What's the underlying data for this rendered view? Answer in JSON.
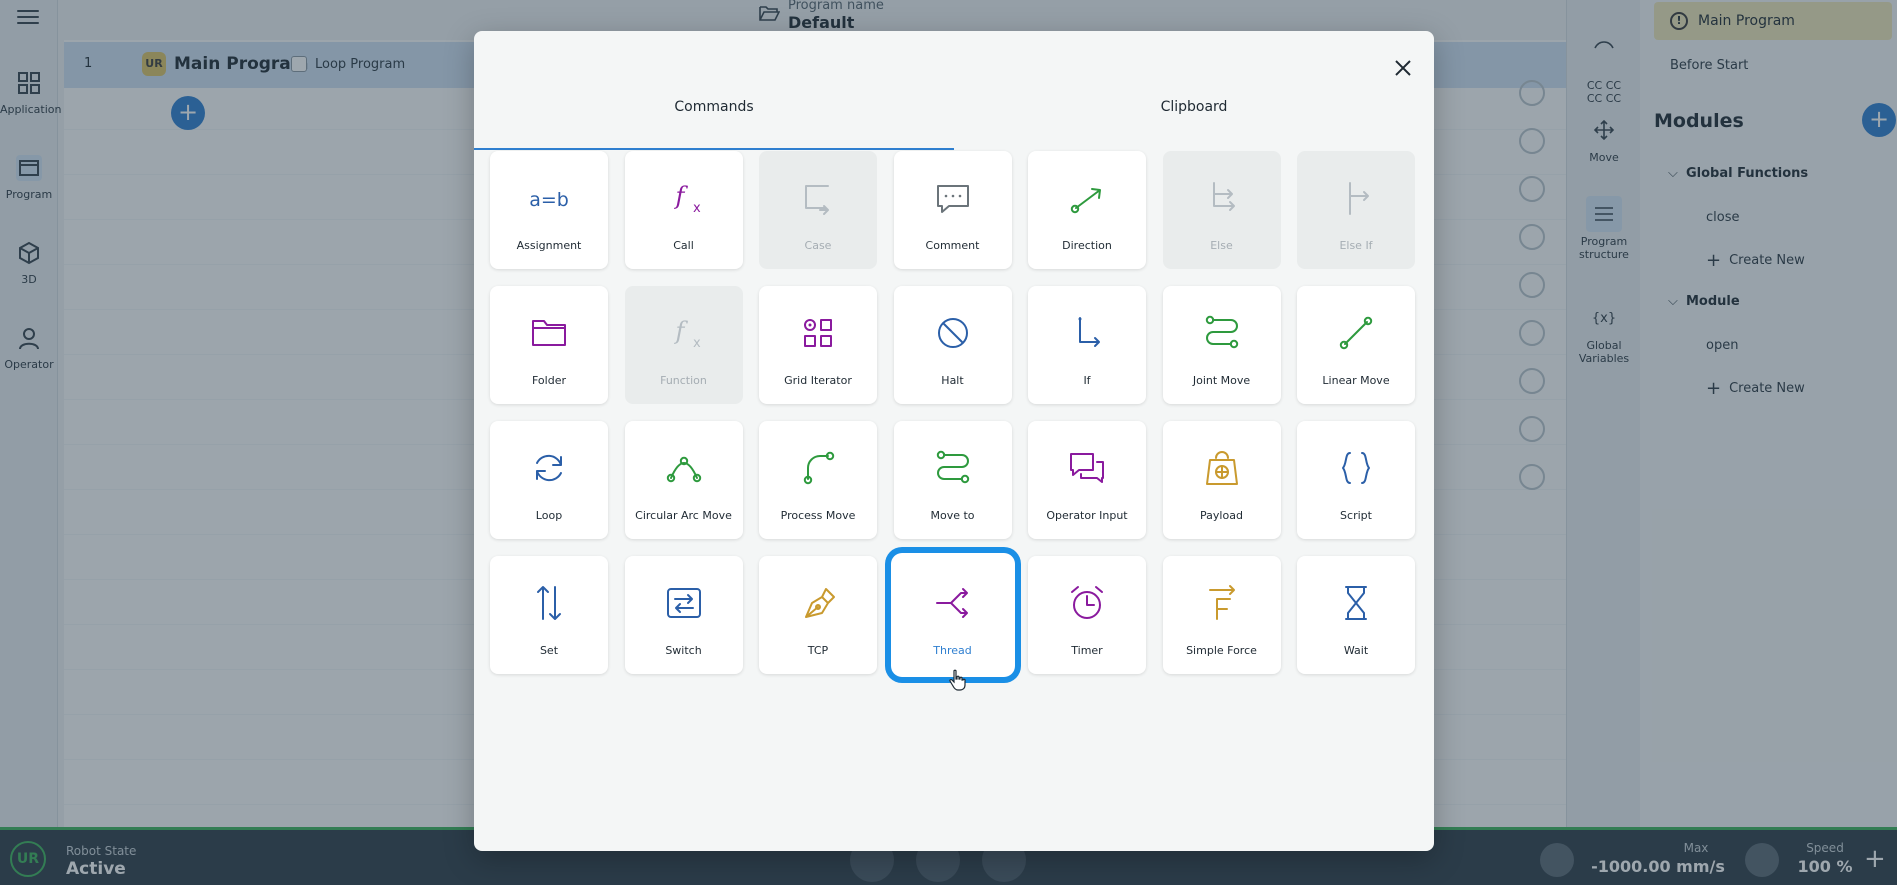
{
  "app": {
    "nav": {
      "application": "Application",
      "program": "Program",
      "3d": "3D",
      "operator": "Operator"
    },
    "program_name_label": "Program name",
    "program_name": "Default",
    "row": {
      "number": "1",
      "badge": "UR",
      "title": "Main Program",
      "loop_label": "Loop Program"
    },
    "right_tabs": {
      "cc": "CC CC\nCC CC",
      "move": "Move",
      "structure": "Program structure",
      "globals": "Global Variables",
      "globals_symbol": "{x}"
    },
    "right_panel": {
      "main_program": "Main Program",
      "before_start": "Before Start",
      "modules_title": "Modules",
      "groups": [
        {
          "name": "Global Functions",
          "items": [
            "close"
          ],
          "create": "Create New"
        },
        {
          "name": "Module",
          "items": [
            "open"
          ],
          "create": "Create New"
        }
      ]
    },
    "bottom": {
      "robot_state_label": "Robot State",
      "robot_state_value": "Active",
      "max_label": "Max",
      "max_value": "-1000.00 mm/s",
      "speed_label": "Speed",
      "speed_value": "100 %"
    }
  },
  "modal": {
    "tabs": [
      "Commands",
      "Clipboard"
    ],
    "active_tab": "Commands",
    "selected": "Thread",
    "commands": [
      {
        "label": "Assignment",
        "icon": "assignment-icon",
        "color": "#2b5fa8",
        "disabled": false
      },
      {
        "label": "Call",
        "icon": "function-call-icon",
        "color": "#8a1a9e",
        "disabled": false
      },
      {
        "label": "Case",
        "icon": "case-icon",
        "color": "#b4bcc2",
        "disabled": true
      },
      {
        "label": "Comment",
        "icon": "comment-icon",
        "color": "#6b747a",
        "disabled": false
      },
      {
        "label": "Direction",
        "icon": "direction-icon",
        "color": "#2e9a3e",
        "disabled": false
      },
      {
        "label": "Else",
        "icon": "else-icon",
        "color": "#b4bcc2",
        "disabled": true
      },
      {
        "label": "Else If",
        "icon": "else-if-icon",
        "color": "#b4bcc2",
        "disabled": true
      },
      {
        "label": "Folder",
        "icon": "folder-icon",
        "color": "#8a1a9e",
        "disabled": false
      },
      {
        "label": "Function",
        "icon": "function-icon",
        "color": "#b4bcc2",
        "disabled": true
      },
      {
        "label": "Grid Iterator",
        "icon": "grid-iterator-icon",
        "color": "#8a1a9e",
        "disabled": false
      },
      {
        "label": "Halt",
        "icon": "halt-icon",
        "color": "#2b5fa8",
        "disabled": false
      },
      {
        "label": "If",
        "icon": "if-icon",
        "color": "#2b5fa8",
        "disabled": false
      },
      {
        "label": "Joint Move",
        "icon": "joint-move-icon",
        "color": "#2e9a3e",
        "disabled": false
      },
      {
        "label": "Linear Move",
        "icon": "linear-move-icon",
        "color": "#2e9a3e",
        "disabled": false
      },
      {
        "label": "Loop",
        "icon": "loop-icon",
        "color": "#2b5fa8",
        "disabled": false
      },
      {
        "label": "Circular Arc Move",
        "icon": "circular-arc-move-icon",
        "color": "#2e9a3e",
        "disabled": false
      },
      {
        "label": "Process Move",
        "icon": "process-move-icon",
        "color": "#2e9a3e",
        "disabled": false
      },
      {
        "label": "Move to",
        "icon": "move-to-icon",
        "color": "#2e9a3e",
        "disabled": false
      },
      {
        "label": "Operator Input",
        "icon": "operator-input-icon",
        "color": "#8a1a9e",
        "disabled": false
      },
      {
        "label": "Payload",
        "icon": "payload-icon",
        "color": "#c99a2e",
        "disabled": false
      },
      {
        "label": "Script",
        "icon": "script-icon",
        "color": "#2b5fa8",
        "disabled": false
      },
      {
        "label": "Set",
        "icon": "set-icon",
        "color": "#2b5fa8",
        "disabled": false
      },
      {
        "label": "Switch",
        "icon": "switch-icon",
        "color": "#2b5fa8",
        "disabled": false
      },
      {
        "label": "TCP",
        "icon": "tcp-icon",
        "color": "#c99a2e",
        "disabled": false
      },
      {
        "label": "Thread",
        "icon": "thread-icon",
        "color": "#8a1a9e",
        "disabled": false
      },
      {
        "label": "Timer",
        "icon": "timer-icon",
        "color": "#8a1a9e",
        "disabled": false
      },
      {
        "label": "Simple Force",
        "icon": "simple-force-icon",
        "color": "#c99a2e",
        "disabled": false
      },
      {
        "label": "Wait",
        "icon": "wait-icon",
        "color": "#2b5fa8",
        "disabled": false
      }
    ]
  }
}
